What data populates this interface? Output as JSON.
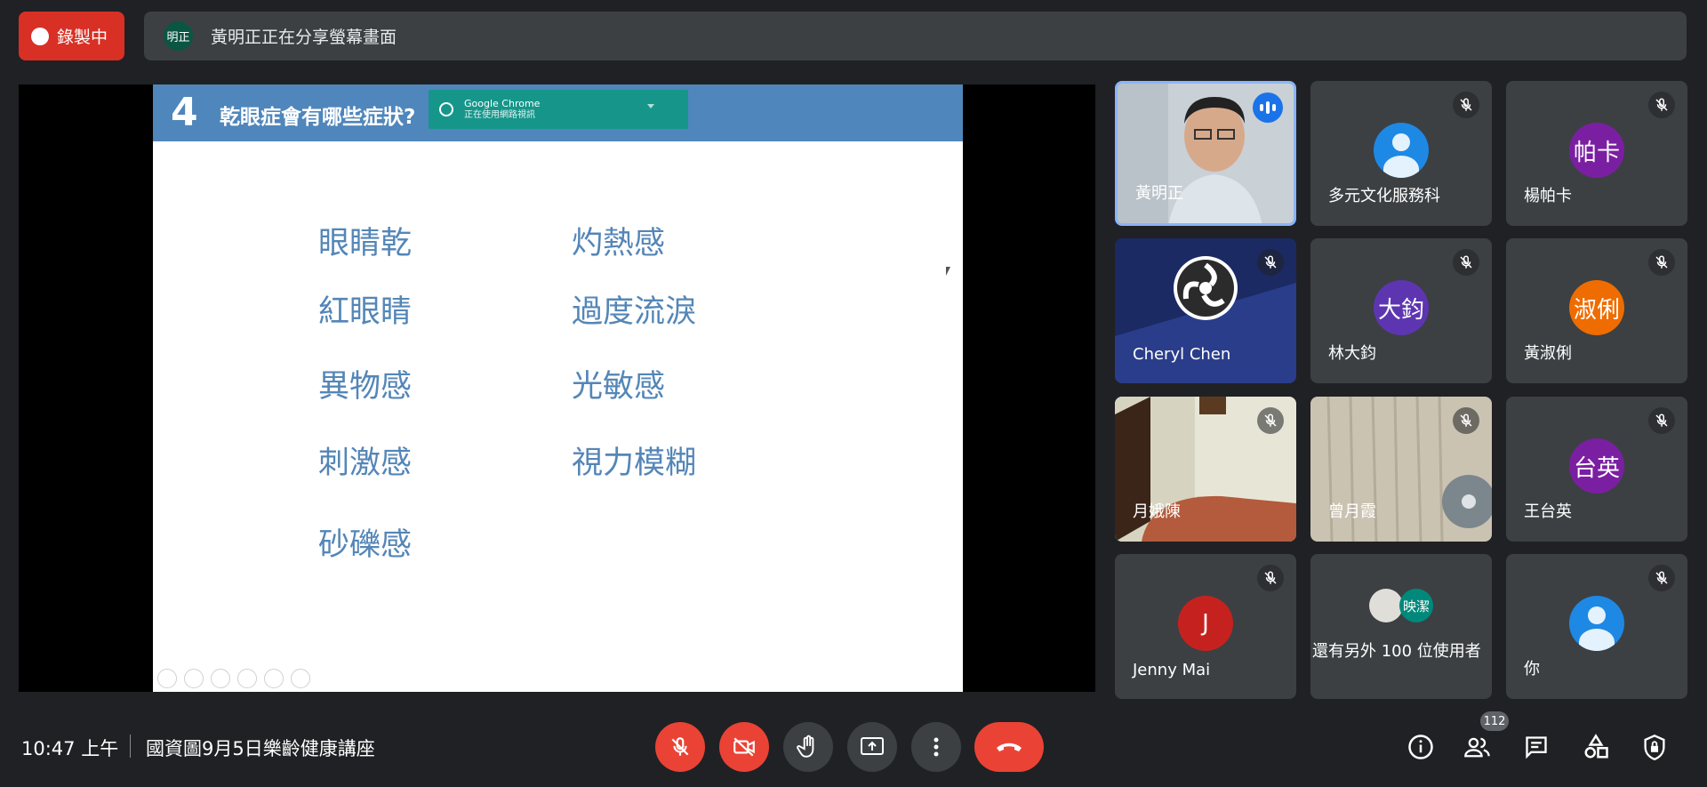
{
  "recording": {
    "label": "錄製中"
  },
  "share_bar": {
    "avatar": "明正",
    "text": "黃明正正在分享螢幕畫面"
  },
  "slide": {
    "number": "4",
    "title": "乾眼症會有哪些症狀?",
    "chrome_notice": {
      "title": "Google Chrome",
      "subtitle": "正在使用網路視訊"
    },
    "symptoms_left": [
      "眼睛乾",
      "紅眼睛",
      "異物感",
      "刺激感",
      "砂礫感"
    ],
    "symptoms_right": [
      "灼熱感",
      "過度流淚",
      "光敏感",
      "視力模糊"
    ]
  },
  "participants": [
    {
      "name": "黃明正",
      "kind": "video",
      "speaking": true
    },
    {
      "name": "多元文化服務科",
      "kind": "generic",
      "muted": true
    },
    {
      "name": "楊帕卡",
      "kind": "initials",
      "initials": "帕卡",
      "color": "#7b1fa2",
      "muted": true
    },
    {
      "name": "Cheryl Chen",
      "kind": "obs",
      "muted": true
    },
    {
      "name": "林大鈞",
      "kind": "initials",
      "initials": "大鈞",
      "color": "#5e35b1",
      "muted": true
    },
    {
      "name": "黃淑俐",
      "kind": "initials",
      "initials": "淑俐",
      "color": "#ef6c00",
      "muted": true
    },
    {
      "name": "月娥陳",
      "kind": "video",
      "muted": true
    },
    {
      "name": "曾月霞",
      "kind": "video",
      "muted": true
    },
    {
      "name": "王台英",
      "kind": "initials",
      "initials": "台英",
      "color": "#7b1fa2",
      "muted": true
    },
    {
      "name": "Jenny Mai",
      "kind": "initials",
      "initials": "J",
      "color": "#c5221f",
      "muted": true
    },
    {
      "name": "還有另外 100 位使用者",
      "kind": "others",
      "mini_avatar": "映潔"
    },
    {
      "name": "你",
      "kind": "generic",
      "muted": true
    }
  ],
  "bottom": {
    "time": "10:47 上午",
    "meeting_name": "國資圖9月5日樂齡健康講座",
    "people_count": "112"
  },
  "colors": {
    "accent": "#1a73e8",
    "danger": "#ea4335",
    "slide_blue": "#4f86bb"
  }
}
